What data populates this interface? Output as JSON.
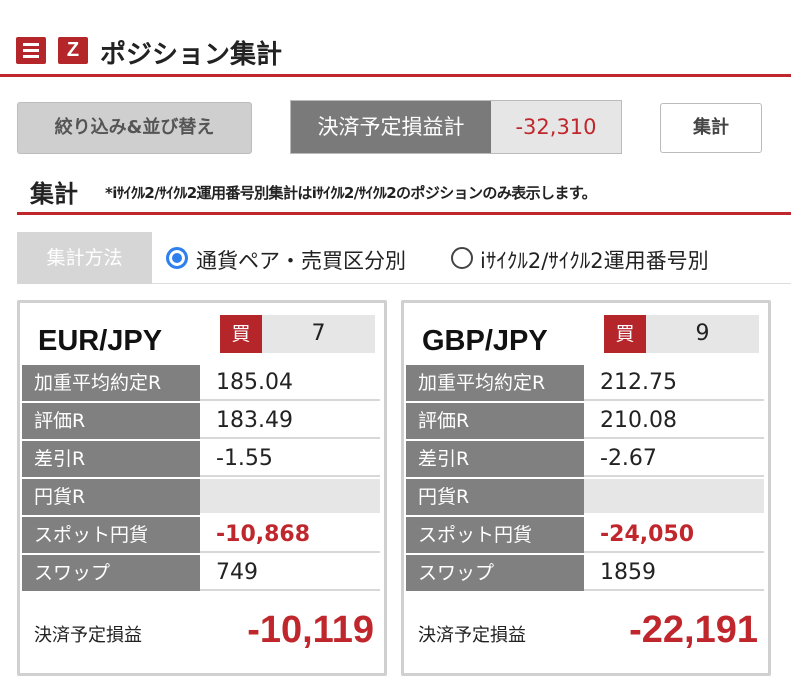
{
  "header": {
    "title": "ポジション集計",
    "menu_icon": "menu-icon",
    "logo_icon": "z-logo-icon",
    "logo_text": "Z"
  },
  "toolbar": {
    "filter_sort_label": "絞り込み&並び替え",
    "expected_pl_label": "決済予定損益計",
    "expected_pl_value": "-32,310",
    "aggregate_label": "集計"
  },
  "section": {
    "title": "集計",
    "note": "*iｻｲｸﾙ2/ｻｲｸﾙ2運用番号別集計はiｻｲｸﾙ2/ｻｲｸﾙ2のポジションのみ表示します。"
  },
  "method": {
    "label": "集計方法",
    "options": [
      {
        "label": "通貨ペア・売買区分別",
        "selected": true
      },
      {
        "label": "iｻｲｸﾙ2/ｻｲｸﾙ2運用番号別",
        "selected": false
      }
    ]
  },
  "cards": [
    {
      "pair": "EUR/JPY",
      "side": "買",
      "quantity": "7",
      "rows": [
        {
          "label": "加重平均約定R",
          "value": "185.04"
        },
        {
          "label": "評価R",
          "value": "183.49"
        },
        {
          "label": "差引R",
          "value": "-1.55"
        },
        {
          "label": "円貨R",
          "value": ""
        },
        {
          "label": "スポット円貨",
          "value": "-10,868"
        },
        {
          "label": "スワップ",
          "value": "749"
        }
      ],
      "total_label": "決済予定損益",
      "total_value": "-10,119"
    },
    {
      "pair": "GBP/JPY",
      "side": "買",
      "quantity": "9",
      "rows": [
        {
          "label": "加重平均約定R",
          "value": "212.75"
        },
        {
          "label": "評価R",
          "value": "210.08"
        },
        {
          "label": "差引R",
          "value": "-2.67"
        },
        {
          "label": "円貨R",
          "value": ""
        },
        {
          "label": "スポット円貨",
          "value": "-24,050"
        },
        {
          "label": "スワップ",
          "value": "1859"
        }
      ],
      "total_label": "決済予定損益",
      "total_value": "-22,191"
    }
  ],
  "colors": {
    "accent_red": "#c0272d",
    "radio_blue": "#2f80ed"
  }
}
